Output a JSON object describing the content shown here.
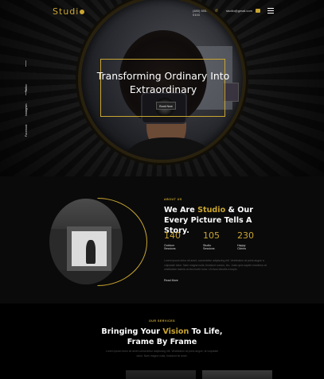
{
  "header": {
    "logo": "Studi",
    "phone": "(480) 555-0103",
    "email": "studio@gmail.com"
  },
  "social": [
    "Facebook",
    "Instagram",
    "Twitter"
  ],
  "hero": {
    "title": "Transforming Ordinary Into Extraordinary",
    "button": "Book Now"
  },
  "about": {
    "eyebrow": "ABOUT US",
    "heading_pre": "We Are ",
    "heading_hl": "Studio",
    "heading_post": " & Our Every Picture Tells A Story.",
    "stats": [
      {
        "value": "140",
        "label": "Outdoor Sessions"
      },
      {
        "value": "105",
        "label": "Studio Sessions"
      },
      {
        "value": "230",
        "label": "Happy Clients"
      }
    ],
    "paragraph": "Lorem ipsum dolor sit amet, consectetur adipiscing elit. Vestibulum at porta augue a vulputate dolor. Nam magna nulla, tincidunt cursus, leo. Justo quis sapien maximus at vestibulum lacinia ut nisi morbi nunc. Ut risus lobortis a turpis.",
    "read_more": "Read More"
  },
  "services": {
    "eyebrow": "OUR SERVICES",
    "heading_pre": "Bringing Your ",
    "heading_hl": "Vision",
    "heading_post": " To Life, Frame By Frame",
    "paragraph": "Lorem ipsum dolor sit amet consectetur adipiscing elit. Vestibulum at porta augue, at vulputate dolor. Nam magna nulla, tincidunt sit amet."
  },
  "colors": {
    "accent": "#c9a531",
    "background": "#0a0a0a"
  }
}
